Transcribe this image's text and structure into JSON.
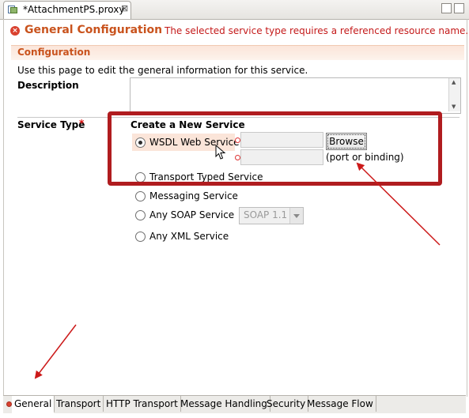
{
  "editor": {
    "file_tab": "*AttachmentPS.proxy",
    "close_glyph": "⊠",
    "header_title": "General Configuration",
    "header_error": "The selected service type requires a referenced resource name."
  },
  "section": {
    "title": "Configuration",
    "description": "Use this page to edit the general information for this service."
  },
  "fields": {
    "description_label": "Description",
    "service_type_label": "Service Type",
    "required_marker": "*",
    "create_title": "Create a New Service"
  },
  "service_options": [
    {
      "label": "WSDL Web Service",
      "selected": true
    },
    {
      "label": "Transport Typed Service",
      "selected": false
    },
    {
      "label": "Messaging Service",
      "selected": false
    },
    {
      "label": "Any SOAP Service",
      "selected": false
    },
    {
      "label": "Any XML Service",
      "selected": false
    }
  ],
  "wsdl": {
    "browse_label": "Browse",
    "port_hint": "(port or binding)"
  },
  "soap_version": {
    "selected": "SOAP 1.1"
  },
  "bottom_tabs": [
    {
      "label": "General",
      "active": true,
      "error": true
    },
    {
      "label": "Transport",
      "active": false
    },
    {
      "label": "HTTP Transport",
      "active": false
    },
    {
      "label": "Message Handling",
      "active": false
    },
    {
      "label": "Security",
      "active": false
    },
    {
      "label": "Message Flow",
      "active": false
    }
  ],
  "colors": {
    "accent": "#c9531d",
    "error": "#c41a1a",
    "callout": "#b01c1f"
  },
  "icons": [
    "proxy-file-icon",
    "close-icon",
    "error-icon",
    "cursor-icon",
    "dropdown-arrow-icon"
  ]
}
